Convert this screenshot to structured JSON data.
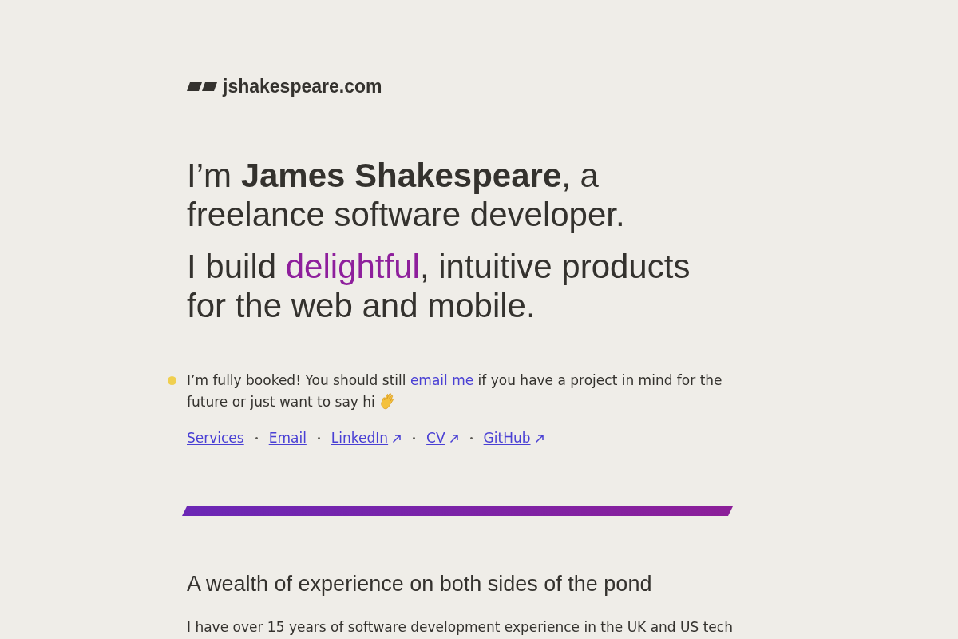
{
  "site": {
    "logo_text": "jshakespeare.com"
  },
  "headline": "I’m **James Shakespeare**, a freelance software developer.",
  "tagline": {
    "before": "I build ",
    "highlight": "delightful",
    "after": ", intuitive products for the web and mobile."
  },
  "availability": {
    "kind": "booked",
    "before": "I’m fully booked! You should still ",
    "link": "email me",
    "after": " if you have a project in mind for the future or just want to say hi"
  },
  "links": [
    {
      "label": "Services",
      "external": false
    },
    {
      "label": "Email",
      "external": false
    },
    {
      "label": "LinkedIn",
      "external": true
    },
    {
      "label": "CV",
      "external": true
    },
    {
      "label": "GitHub",
      "external": true
    }
  ],
  "section": {
    "heading": "A wealth of experience on both sides of the pond",
    "paragraph": "I have over 15 years of software development experience in the UK and US tech"
  }
}
